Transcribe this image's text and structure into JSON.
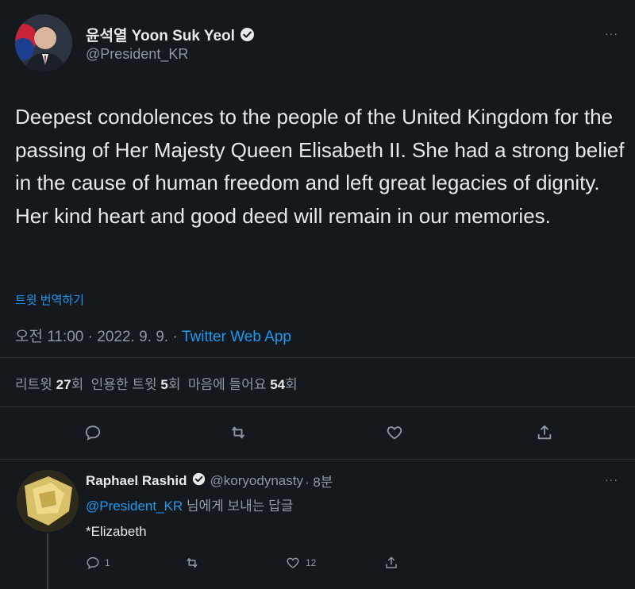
{
  "tweet": {
    "display_name": "윤석열 Yoon Suk Yeol",
    "handle": "@President_KR",
    "more_icon": "···",
    "text": "Deepest condolences to the people of the United Kingdom for the passing of Her Majesty Queen Elisabeth II. She had a strong belief in the cause of human freedom and left great legacies of dignity. Her kind heart and good deed will remain in our memories.",
    "translate_label": "트윗 번역하기",
    "time": "오전 11:00",
    "date": "2022. 9. 9.",
    "source": "Twitter Web App",
    "stats": {
      "retweets_label": "리트윗",
      "retweets": "27",
      "retweets_suffix": "회",
      "quotes_label": "인용한 트윗",
      "quotes": "5",
      "quotes_suffix": "회",
      "likes_label": "마음에 들어요",
      "likes": "54",
      "likes_suffix": "회"
    }
  },
  "reply": {
    "display_name": "Raphael Rashid",
    "handle": "@koryodynasty",
    "time": "· 8분",
    "replying_to_handle": "@President_KR",
    "replying_to_suffix": " 님에게 보내는 답글",
    "text": "*Elizabeth",
    "more_icon": "···",
    "reply_count": "1",
    "like_count": "12"
  },
  "colors": {
    "background": "#15181c",
    "accent": "#1d9bf0",
    "muted": "#8b98a5",
    "text": "#e7e9ea"
  }
}
